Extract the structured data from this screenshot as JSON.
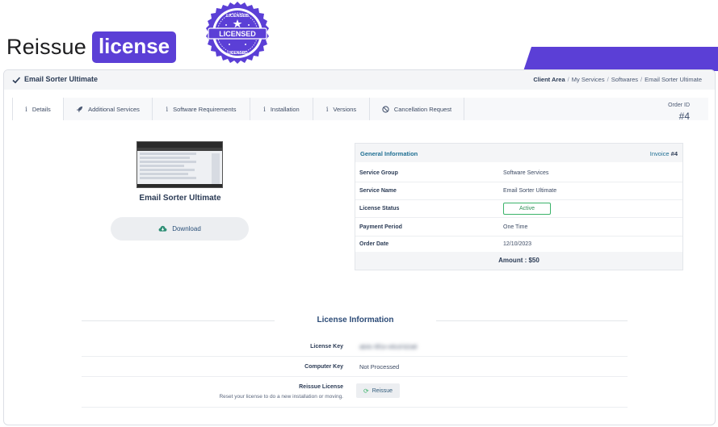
{
  "promo": {
    "title_word": "Reissue",
    "title_badge": "license",
    "seal_top": "LICENSED",
    "seal_center": "LICENSED",
    "seal_bottom": "LICENSED",
    "accent": "#5b3fd6"
  },
  "header": {
    "product_title": "Email Sorter Ultimate",
    "breadcrumb": [
      "Client Area",
      "My Services",
      "Softwares",
      "Email Sorter Ultimate"
    ]
  },
  "tabs": [
    {
      "label": "Details",
      "icon": "info-icon",
      "active": true
    },
    {
      "label": "Additional Services",
      "icon": "rocket-icon",
      "active": false
    },
    {
      "label": "Software Requirements",
      "icon": "info-icon",
      "active": false
    },
    {
      "label": "Installation",
      "icon": "info-icon",
      "active": false
    },
    {
      "label": "Versions",
      "icon": "info-icon",
      "active": false
    },
    {
      "label": "Cancellation Request",
      "icon": "ban-icon",
      "active": false
    }
  ],
  "order": {
    "label": "Order ID",
    "number": "#4"
  },
  "product_card": {
    "caption": "Email Sorter Ultimate",
    "download_label": "Download"
  },
  "general_info": {
    "title": "General Information",
    "invoice_label": "Invoice",
    "invoice_number": "#4",
    "rows": [
      {
        "label": "Service Group",
        "value": "Software Services"
      },
      {
        "label": "Service Name",
        "value": "Email Sorter Ultimate"
      },
      {
        "label": "License Status",
        "value": "Active"
      },
      {
        "label": "Payment Period",
        "value": "One Time"
      },
      {
        "label": "Order Date",
        "value": "12/10/2023"
      }
    ],
    "amount": "Amount : $50",
    "status_color": "#3bb36a"
  },
  "license_info": {
    "title": "License Information",
    "license_key_label": "License Key",
    "license_key_value": "ab4c-9f1e-e6cd-b2a8",
    "computer_key_label": "Computer Key",
    "computer_key_value": "Not Processed",
    "reissue_label": "Reissue License",
    "reissue_sub": "Reset your license to do a new installation or moving.",
    "reissue_button": "Reissue"
  }
}
